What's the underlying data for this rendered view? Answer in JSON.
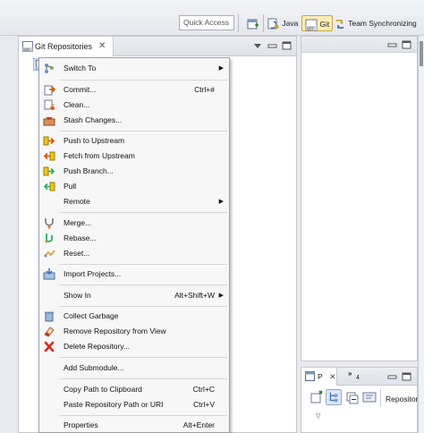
{
  "toolbar": {
    "quick_access_placeholder": "Quick Access",
    "perspectives": [
      {
        "label": "Java",
        "active": false
      },
      {
        "label": "Git",
        "active": true
      },
      {
        "label": "Team Synchronizing",
        "active": false
      }
    ]
  },
  "left_view": {
    "tab_label": "Git Repositories",
    "close_glyph": "✕"
  },
  "context_menu": {
    "items": [
      {
        "label": "Switch To",
        "shortcut": "",
        "submenu": true,
        "icon": "switch-branch-icon"
      },
      {
        "label": "Commit...",
        "shortcut": "Ctrl+#",
        "submenu": false,
        "icon": "commit-icon"
      },
      {
        "label": "Clean...",
        "shortcut": "",
        "submenu": false,
        "icon": "clean-icon"
      },
      {
        "label": "Stash Changes...",
        "shortcut": "",
        "submenu": false,
        "icon": "stash-icon"
      },
      {
        "label": "Push to Upstream",
        "shortcut": "",
        "submenu": false,
        "icon": "push-upstream-icon"
      },
      {
        "label": "Fetch from Upstream",
        "shortcut": "",
        "submenu": false,
        "icon": "fetch-upstream-icon"
      },
      {
        "label": "Push Branch...",
        "shortcut": "",
        "submenu": false,
        "icon": "push-branch-icon"
      },
      {
        "label": "Pull",
        "shortcut": "",
        "submenu": false,
        "icon": "pull-icon"
      },
      {
        "label": "Remote",
        "shortcut": "",
        "submenu": true,
        "icon": ""
      },
      {
        "label": "Merge...",
        "shortcut": "",
        "submenu": false,
        "icon": "merge-icon"
      },
      {
        "label": "Rebase...",
        "shortcut": "",
        "submenu": false,
        "icon": "rebase-icon"
      },
      {
        "label": "Reset...",
        "shortcut": "",
        "submenu": false,
        "icon": "reset-icon"
      },
      {
        "label": "Import Projects...",
        "shortcut": "",
        "submenu": false,
        "icon": "import-projects-icon"
      },
      {
        "label": "Show In",
        "shortcut": "Alt+Shift+W",
        "submenu": true,
        "icon": ""
      },
      {
        "label": "Collect Garbage",
        "shortcut": "",
        "submenu": false,
        "icon": "trash-can-icon"
      },
      {
        "label": "Remove Repository from View",
        "shortcut": "",
        "submenu": false,
        "icon": "eraser-icon"
      },
      {
        "label": "Delete Repository...",
        "shortcut": "",
        "submenu": false,
        "icon": "red-x-icon"
      },
      {
        "label": "Add Submodule...",
        "shortcut": "",
        "submenu": false,
        "icon": ""
      },
      {
        "label": "Copy Path to Clipboard",
        "shortcut": "Ctrl+C",
        "submenu": false,
        "icon": ""
      },
      {
        "label": "Paste Repository Path or URI",
        "shortcut": "Ctrl+V",
        "submenu": false,
        "icon": ""
      },
      {
        "label": "Properties",
        "shortcut": "Alt+Enter",
        "submenu": false,
        "icon": ""
      }
    ]
  },
  "bottom_right_view": {
    "tab_label": "P",
    "close_glyph": "✕",
    "more_tabs_glyph": "»",
    "more_tabs_count": "4",
    "toolbar_label": "Repositor",
    "dropdown_glyph": "▽"
  },
  "colors": {
    "menu_background": "#f7f7f8",
    "selection": "#cfe0f6",
    "active_perspective": "#f9edb8"
  }
}
